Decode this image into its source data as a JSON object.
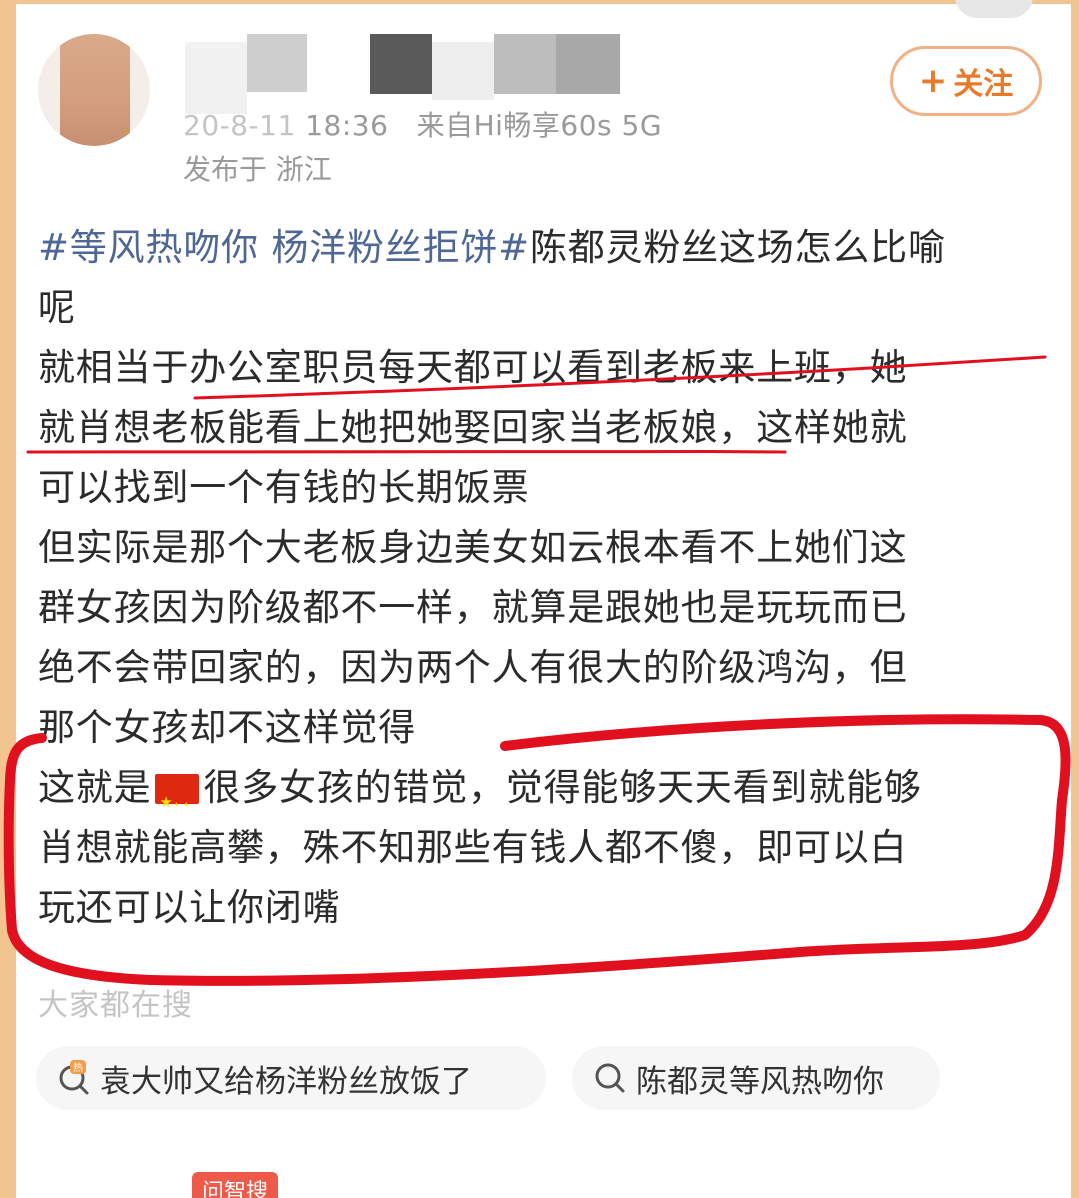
{
  "post": {
    "author": {
      "time_fragment": "20-8-11",
      "time": "18:36",
      "source": "来自Hi畅享60s 5G",
      "location": "发布于 浙江"
    },
    "follow_label": "关注",
    "lines": [
      {
        "tag": "#等风热吻你 杨洋粉丝拒饼#",
        "text": "陈都灵粉丝这场怎么比喻"
      },
      {
        "text": "呢"
      },
      {
        "text": "就相当于办公室职员每天都可以看到老板来上班，她"
      },
      {
        "text": "就肖想老板能看上她把她娶回家当老板娘，这样她就"
      },
      {
        "text": "可以找到一个有钱的长期饭票"
      },
      {
        "text": "但实际是那个大老板身边美女如云根本看不上她们这"
      },
      {
        "text": "群女孩因为阶级都不一样，就算是跟她也是玩玩而已"
      },
      {
        "text": "绝不会带回家的，因为两个人有很大的阶级鸿沟，但"
      },
      {
        "text": "那个女孩却不这样觉得"
      },
      {
        "before_flag": "这就是",
        "after_flag": "很多女孩的错觉，觉得能够天天看到就能够"
      },
      {
        "text": "肖想就能高攀，殊不知那些有钱人都不傻，即可以白"
      },
      {
        "text": "玩还可以让你闭嘴"
      }
    ]
  },
  "search": {
    "section_title": "大家都在搜",
    "chips": [
      {
        "label": "袁大帅又给杨洋粉丝放饭了",
        "icon": "hot-search-icon",
        "icon_badge": "热"
      },
      {
        "label": "陈都灵等风热吻你",
        "icon": "search-icon"
      }
    ]
  },
  "bottom": {
    "badge_label": "问智搜"
  },
  "colors": {
    "accent_orange": "#e97a2a",
    "topic_blue": "#4f6794",
    "annotation_red": "#e0101e",
    "frame_orange": "#f2c48f"
  }
}
